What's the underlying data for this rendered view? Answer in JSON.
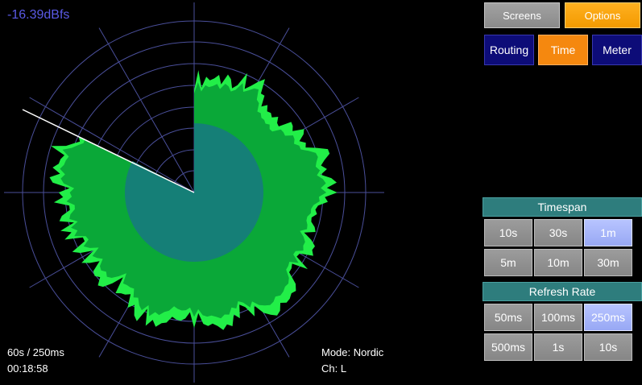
{
  "level": {
    "value": "-16.39dBfs"
  },
  "status": {
    "timespan_rate": "60s / 250ms",
    "elapsed": "00:18:58",
    "mode": "Mode: Nordic",
    "channel": "Ch: L"
  },
  "top_buttons": {
    "screens": "Screens",
    "options": "Options"
  },
  "nav": {
    "routing": "Routing",
    "time": "Time",
    "meter": "Meter"
  },
  "timespan": {
    "title": "Timespan",
    "options": [
      "10s",
      "30s",
      "1m",
      "5m",
      "10m",
      "30m"
    ],
    "selected": "1m"
  },
  "refresh": {
    "title": "Refresh Rate",
    "options": [
      "50ms",
      "100ms",
      "250ms",
      "500ms",
      "1s",
      "10s"
    ],
    "selected": "250ms"
  },
  "colors": {
    "background": "#000000",
    "level_text": "#5a5ae6",
    "inner_disc": "#157f77",
    "history_fill": "#0aa838",
    "peak_fill": "#22ee48",
    "grid": "#4a4f9a",
    "sweep": "#ffffff",
    "nav_navy": "#0d0c78",
    "nav_active": "#f5880f",
    "section_header": "#2e7d7d",
    "selected_option": "#a8b6ff"
  }
}
